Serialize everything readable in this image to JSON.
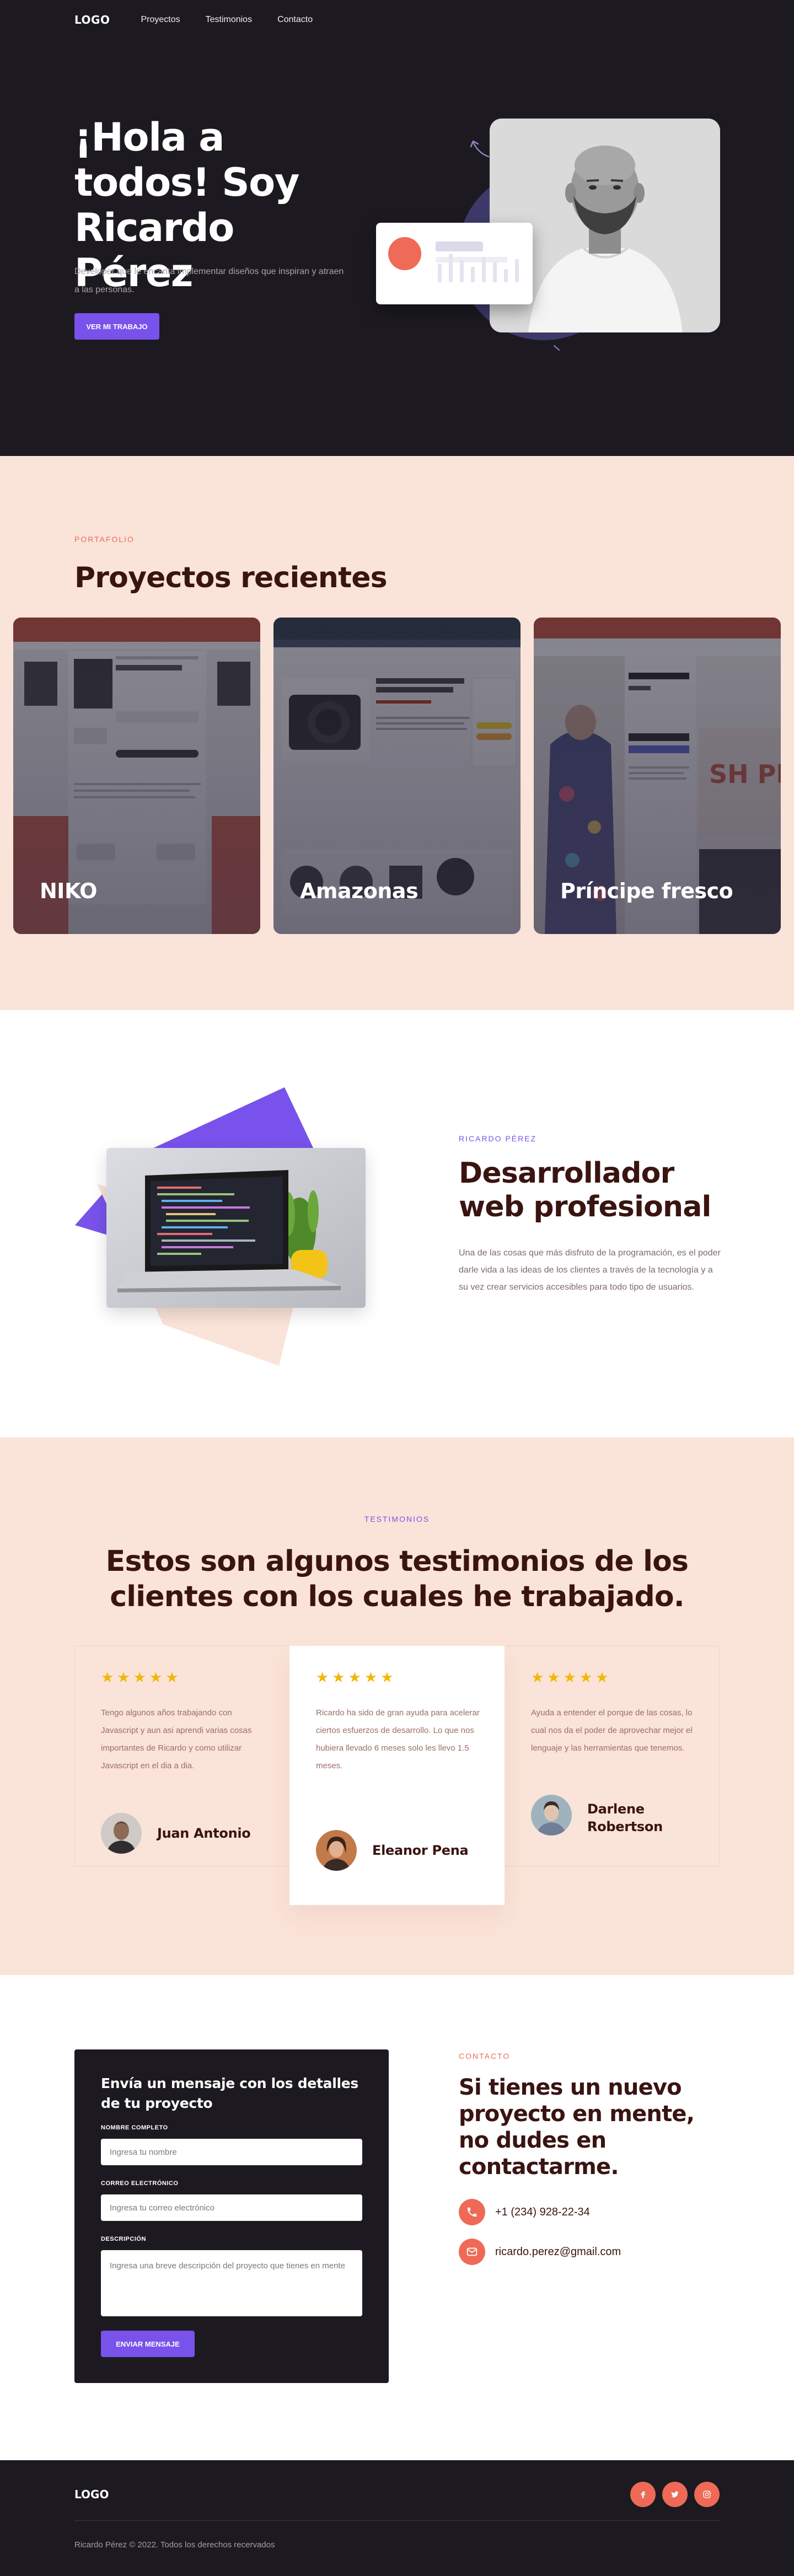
{
  "nav": {
    "logo": "LOGO",
    "links": [
      "Proyectos",
      "Testimonios",
      "Contacto"
    ]
  },
  "hero": {
    "title": "¡Hola a todos! Soy Ricardo Pérez",
    "subtitle": "Developer que le encanta implementar diseños que inspiran y atraen a las personas.",
    "cta": "VER MI TRABAJO"
  },
  "portfolio": {
    "eyebrow": "PORTAFOLIO",
    "title": "Proyectos recientes",
    "projects": [
      {
        "label": "NIKO"
      },
      {
        "label": "Amazonas"
      },
      {
        "label": "Príncipe fresco"
      }
    ]
  },
  "about": {
    "eyebrow": "RICARDO PÉREZ",
    "title": "Desarrollador web profesional",
    "text": "Una de las cosas que más disfruto de la programación, es el poder darle vida a las ideas de los clientes a través de la tecnología y a su vez crear servicios accesibles para todo tipo de usuarios."
  },
  "testimonials": {
    "eyebrow": "TESTIMONIOS",
    "title": "Estos son algunos testimonios de los clientes con los cuales he trabajado.",
    "items": [
      {
        "stars": "★★★★★",
        "quote": "Tengo algunos años trabajando con Javascript y aun asi aprendi varias cosas importantes de Ricardo y como utilizar Javascript en el dia a dia.",
        "name": "Juan Antonio"
      },
      {
        "stars": "★★★★★",
        "quote": "Ricardo ha sido de gran ayuda para acelerar ciertos esfuerzos de desarrollo. Lo que nos hubiera llevado 6 meses solo les llevo 1.5 meses.",
        "name": "Eleanor Pena"
      },
      {
        "stars": "★★★★★",
        "quote": "Ayuda a entender el porque de las cosas, lo cual nos da el poder de aprovechar mejor el lenguaje y las herramientas que tenemos.",
        "name": "Darlene Robertson"
      }
    ]
  },
  "contact": {
    "form_title": "Envía un mensaje con los detalles de tu proyecto",
    "name_label": "NOMBRE COMPLETO",
    "name_placeholder": "Ingresa tu nombre",
    "email_label": "CORREO ELECTRÓNICO",
    "email_placeholder": "Ingresa tu correo electrónico",
    "desc_label": "DESCRIPCIÓN",
    "desc_placeholder": "Ingresa una breve descripción del proyecto que tienes en mente",
    "send": "ENVIAR MENSAJE",
    "eyebrow": "CONTACTO",
    "title": "Si tienes un nuevo proyecto en mente, no dudes en contactarme.",
    "phone": "+1 (234) 928-22-34",
    "email": "ricardo.perez@gmail.com"
  },
  "footer": {
    "logo": "LOGO",
    "copyright": "Ricardo Pérez © 2022. Todos los derechos recervados"
  },
  "colors": {
    "dark": "#1c1a20",
    "peach": "#fae3d8",
    "accent": "#7852eb",
    "coral": "#ee6a57",
    "star": "#f2b705"
  }
}
